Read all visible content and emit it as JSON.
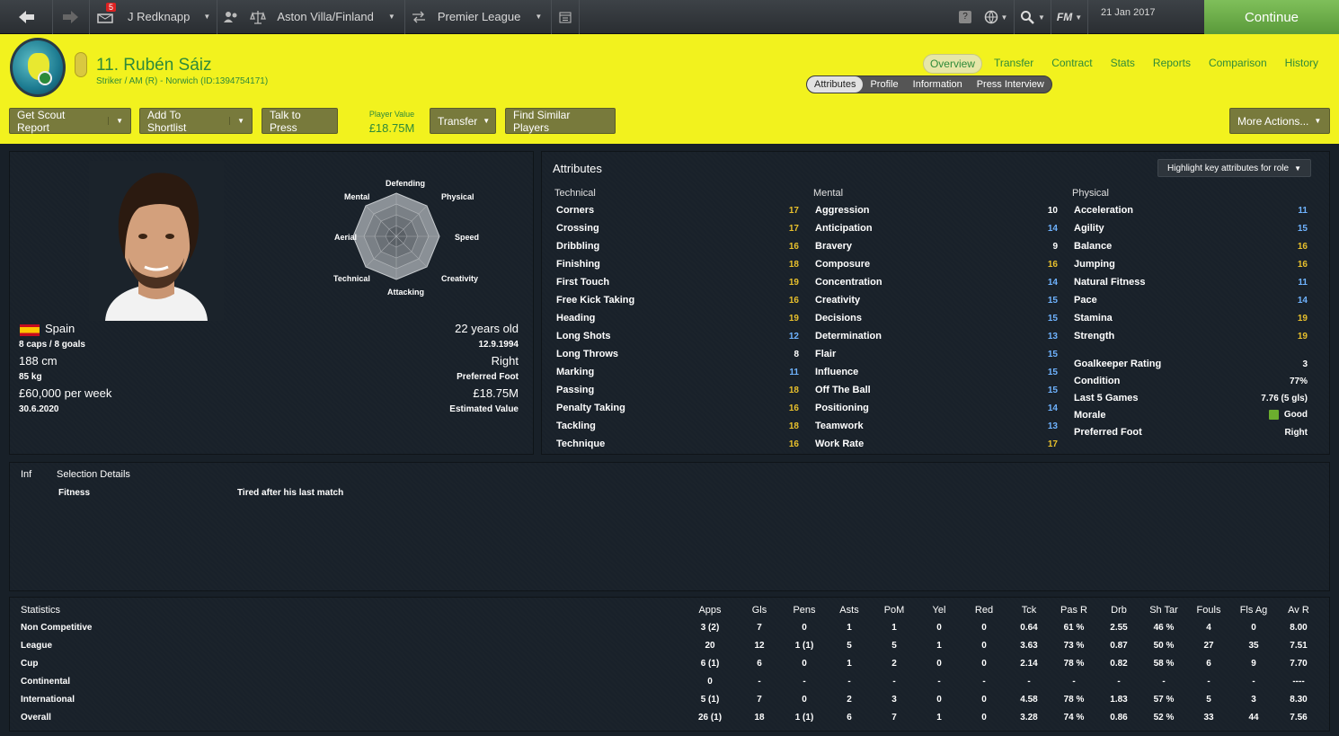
{
  "topbar": {
    "mail_count": "5",
    "manager": "J Redknapp",
    "club_nation": "Aston Villa/Finland",
    "competition": "Premier League",
    "fm_label": "FM",
    "date": "21 Jan 2017",
    "continue_label": "Continue"
  },
  "player": {
    "name": "11. Rubén Sáiz",
    "subtitle": "Striker / AM (R) - Norwich (ID:1394754171)"
  },
  "tabs": {
    "main": [
      "Overview",
      "Transfer",
      "Contract",
      "Stats",
      "Reports",
      "Comparison",
      "History"
    ],
    "sub": [
      "Attributes",
      "Profile",
      "Information",
      "Press Interview"
    ]
  },
  "actions": {
    "scout": "Get Scout Report",
    "shortlist": "Add To Shortlist",
    "press": "Talk to Press",
    "value_label": "Player Value",
    "value": "£18.75M",
    "transfer": "Transfer",
    "similar": "Find Similar Players",
    "more": "More Actions..."
  },
  "profile": {
    "nation": "Spain",
    "caps": "8 caps / 8 goals",
    "height": "188 cm",
    "weight": "85 kg",
    "wage": "£60,000 per week",
    "contract": "30.6.2020",
    "age": "22 years old",
    "dob": "12.9.1994",
    "foot": "Right",
    "foot_label": "Preferred Foot",
    "est_value": "£18.75M",
    "est_value_label": "Estimated Value",
    "radar": {
      "labels": [
        "Defending",
        "Physical",
        "Speed",
        "Creativity",
        "Attacking",
        "Technical",
        "Aerial",
        "Mental"
      ]
    }
  },
  "attributes": {
    "title": "Attributes",
    "highlight_label": "Highlight key attributes for role",
    "technical_title": "Technical",
    "mental_title": "Mental",
    "physical_title": "Physical",
    "technical": [
      {
        "name": "Corners",
        "value": "17",
        "color": "y"
      },
      {
        "name": "Crossing",
        "value": "17",
        "color": "y"
      },
      {
        "name": "Dribbling",
        "value": "16",
        "color": "y"
      },
      {
        "name": "Finishing",
        "value": "18",
        "color": "y"
      },
      {
        "name": "First Touch",
        "value": "19",
        "color": "y"
      },
      {
        "name": "Free Kick Taking",
        "value": "16",
        "color": "y"
      },
      {
        "name": "Heading",
        "value": "19",
        "color": "y"
      },
      {
        "name": "Long Shots",
        "value": "12",
        "color": "b"
      },
      {
        "name": "Long Throws",
        "value": "8",
        "color": "w"
      },
      {
        "name": "Marking",
        "value": "11",
        "color": "b"
      },
      {
        "name": "Passing",
        "value": "18",
        "color": "y"
      },
      {
        "name": "Penalty Taking",
        "value": "16",
        "color": "y"
      },
      {
        "name": "Tackling",
        "value": "18",
        "color": "y"
      },
      {
        "name": "Technique",
        "value": "16",
        "color": "y"
      }
    ],
    "mental": [
      {
        "name": "Aggression",
        "value": "10",
        "color": "w"
      },
      {
        "name": "Anticipation",
        "value": "14",
        "color": "b"
      },
      {
        "name": "Bravery",
        "value": "9",
        "color": "w"
      },
      {
        "name": "Composure",
        "value": "16",
        "color": "y"
      },
      {
        "name": "Concentration",
        "value": "14",
        "color": "b"
      },
      {
        "name": "Creativity",
        "value": "15",
        "color": "b"
      },
      {
        "name": "Decisions",
        "value": "15",
        "color": "b"
      },
      {
        "name": "Determination",
        "value": "13",
        "color": "b"
      },
      {
        "name": "Flair",
        "value": "15",
        "color": "b"
      },
      {
        "name": "Influence",
        "value": "15",
        "color": "b"
      },
      {
        "name": "Off The Ball",
        "value": "15",
        "color": "b"
      },
      {
        "name": "Positioning",
        "value": "14",
        "color": "b"
      },
      {
        "name": "Teamwork",
        "value": "13",
        "color": "b"
      },
      {
        "name": "Work Rate",
        "value": "17",
        "color": "y"
      }
    ],
    "physical": [
      {
        "name": "Acceleration",
        "value": "11",
        "color": "b"
      },
      {
        "name": "Agility",
        "value": "15",
        "color": "b"
      },
      {
        "name": "Balance",
        "value": "16",
        "color": "y"
      },
      {
        "name": "Jumping",
        "value": "16",
        "color": "y"
      },
      {
        "name": "Natural Fitness",
        "value": "11",
        "color": "b"
      },
      {
        "name": "Pace",
        "value": "14",
        "color": "b"
      },
      {
        "name": "Stamina",
        "value": "19",
        "color": "y"
      },
      {
        "name": "Strength",
        "value": "19",
        "color": "y"
      }
    ],
    "extra": [
      {
        "name": "Goalkeeper Rating",
        "value": "3"
      },
      {
        "name": "Condition",
        "value": "77%"
      },
      {
        "name": "Last 5 Games",
        "value": "7.76 (5 gls)"
      },
      {
        "name": "Morale",
        "value": "Good"
      },
      {
        "name": "Preferred Foot",
        "value": "Right"
      }
    ]
  },
  "info": {
    "inf_label": "Inf",
    "selection_label": "Selection Details",
    "fitness_label": "Fitness",
    "fitness_value": "Tired after his last match"
  },
  "stats": {
    "title": "Statistics",
    "columns": [
      "Apps",
      "Gls",
      "Pens",
      "Asts",
      "PoM",
      "Yel",
      "Red",
      "Tck",
      "Pas R",
      "Drb",
      "Sh Tar",
      "Fouls",
      "Fls Ag",
      "Av R"
    ],
    "rows": [
      {
        "label": "Non Competitive",
        "values": [
          "3 (2)",
          "7",
          "0",
          "1",
          "1",
          "0",
          "0",
          "0.64",
          "61 %",
          "2.55",
          "46 %",
          "4",
          "0",
          "8.00"
        ]
      },
      {
        "label": "League",
        "values": [
          "20",
          "12",
          "1 (1)",
          "5",
          "5",
          "1",
          "0",
          "3.63",
          "73 %",
          "0.87",
          "50 %",
          "27",
          "35",
          "7.51"
        ]
      },
      {
        "label": "Cup",
        "values": [
          "6 (1)",
          "6",
          "0",
          "1",
          "2",
          "0",
          "0",
          "2.14",
          "78 %",
          "0.82",
          "58 %",
          "6",
          "9",
          "7.70"
        ]
      },
      {
        "label": "Continental",
        "values": [
          "0",
          "-",
          "-",
          "-",
          "-",
          "-",
          "-",
          "-",
          "-",
          "-",
          "-",
          "-",
          "-",
          "----"
        ]
      },
      {
        "label": "International",
        "values": [
          "5 (1)",
          "7",
          "0",
          "2",
          "3",
          "0",
          "0",
          "4.58",
          "78 %",
          "1.83",
          "57 %",
          "5",
          "3",
          "8.30"
        ]
      },
      {
        "label": "Overall",
        "values": [
          "26 (1)",
          "18",
          "1 (1)",
          "6",
          "7",
          "1",
          "0",
          "3.28",
          "74 %",
          "0.86",
          "52 %",
          "33",
          "44",
          "7.56"
        ]
      }
    ]
  }
}
